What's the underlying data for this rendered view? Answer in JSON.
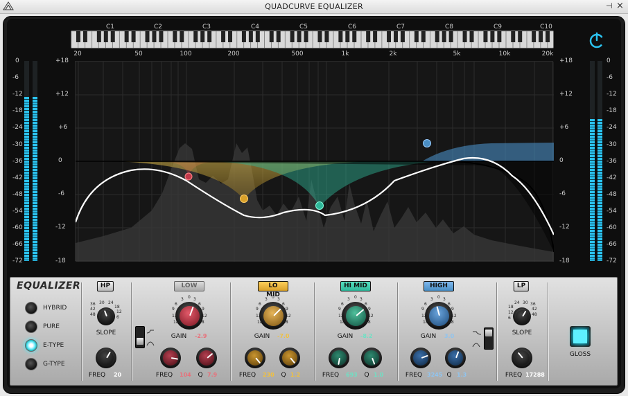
{
  "window": {
    "title": "QUADCURVE EQUALIZER",
    "pin_glyph": "⊣",
    "close_glyph": "×"
  },
  "octaves": [
    "C1",
    "C2",
    "C3",
    "C4",
    "C5",
    "C6",
    "C7",
    "C8",
    "C9",
    "C10"
  ],
  "hz_labels": [
    "20",
    "50",
    "100",
    "200",
    "500",
    "1k",
    "2k",
    "5k",
    "10k",
    "20k"
  ],
  "db_labels": [
    "+18",
    "+12",
    "+6",
    "0",
    "-6",
    "-12",
    "-18"
  ],
  "meter_labels": [
    "0",
    "-6",
    "-12",
    "-18",
    "-24",
    "-30",
    "-36",
    "-42",
    "-48",
    "-54",
    "-60",
    "-66",
    "-72"
  ],
  "meters": {
    "left_levels": [
      0.82,
      0.82
    ],
    "right_levels": [
      0.71,
      0.71
    ]
  },
  "colors": {
    "accent": "#2bc3f0",
    "low": "#c23a4b",
    "lomid": "#d9a12a",
    "himid": "#2fb79a",
    "high": "#4a8ec4"
  },
  "equalizer": {
    "title": "EQUALIZER",
    "modes": [
      "HYBRID",
      "PURE",
      "E-TYPE",
      "G-TYPE"
    ],
    "selected_mode": "E-TYPE"
  },
  "hp": {
    "label": "HP",
    "slope_label": "SLOPE",
    "slope_scale": [
      "36",
      "30",
      "24",
      "18",
      "12",
      "6",
      "42",
      "48"
    ],
    "freq_label": "FREQ",
    "freq_value": "20"
  },
  "low": {
    "label": "LOW",
    "gain_label": "GAIN",
    "gain_value": "-2.9",
    "freq_label": "FREQ",
    "freq_value": "104",
    "q_label": "Q",
    "q_value": "7.9"
  },
  "lomid": {
    "label": "LO MID",
    "gain_label": "GAIN",
    "gain_value": "-7.0",
    "freq_label": "FREQ",
    "freq_value": "230",
    "q_label": "Q",
    "q_value": "1.2"
  },
  "himid": {
    "label": "HI MID",
    "gain_label": "GAIN",
    "gain_value": "-8.2",
    "freq_label": "FREQ",
    "freq_value": "693",
    "q_label": "Q",
    "q_value": "1.0"
  },
  "high": {
    "label": "HIGH",
    "gain_label": "GAIN",
    "gain_value": "3.0",
    "freq_label": "FREQ",
    "freq_value": "3245",
    "q_label": "Q",
    "q_value": "1.3"
  },
  "lp": {
    "label": "LP",
    "slope_label": "SLOPE",
    "slope_scale": [
      "24",
      "30",
      "36",
      "18",
      "42",
      "12",
      "48",
      "6"
    ],
    "freq_label": "FREQ",
    "freq_value": "17288"
  },
  "gain_scale": [
    "0",
    "3",
    "3",
    "6",
    "6",
    "9",
    "9",
    "12",
    "12",
    "18",
    "18"
  ],
  "gloss": {
    "label": "GLOSS"
  },
  "power": {
    "state": "on"
  }
}
